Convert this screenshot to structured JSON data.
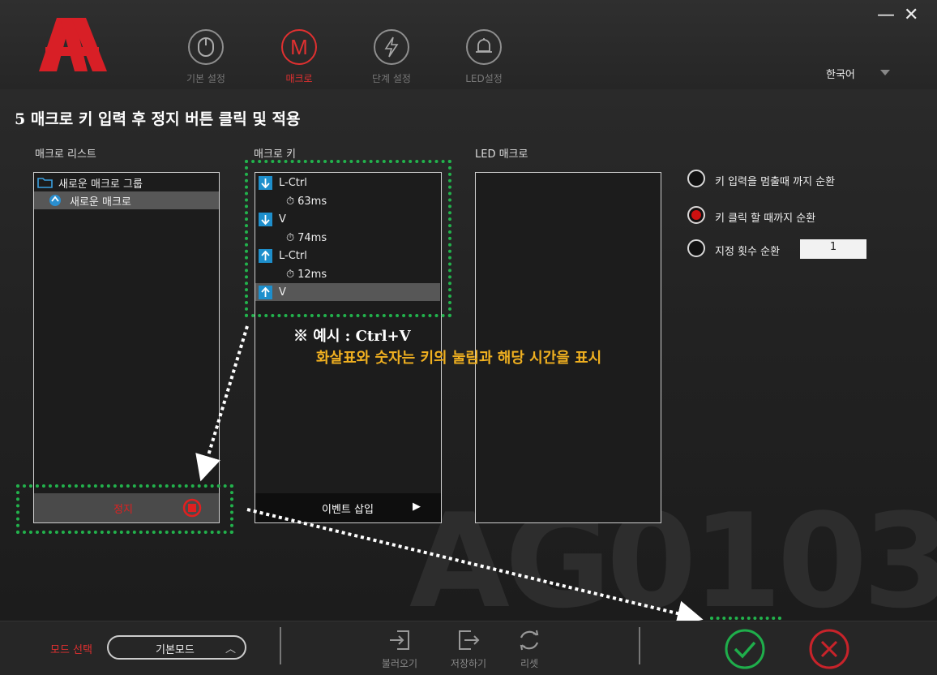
{
  "nav": {
    "tabs": [
      {
        "label": "기본 설정",
        "icon": "mouse-icon"
      },
      {
        "label": "매크로",
        "icon": "macro-m-icon",
        "active": true
      },
      {
        "label": "단계 설정",
        "icon": "lightning-icon"
      },
      {
        "label": "LED설정",
        "icon": "bell-icon"
      }
    ]
  },
  "window": {
    "minimize": "—",
    "close": "✕"
  },
  "language": "한국어",
  "instruction": "5 매크로 키 입력 후 정지 버튼 클릭 및 적용",
  "macro_list": {
    "title": "매크로 리스트",
    "group": "새로운 매크로 그룹",
    "item": "새로운 매크로",
    "stop_label": "정지"
  },
  "macro_keys": {
    "title": "매크로 키",
    "events": [
      {
        "dir": "down",
        "key": "L-Ctrl",
        "delay": "63ms"
      },
      {
        "dir": "down",
        "key": "V",
        "delay": "74ms"
      },
      {
        "dir": "up",
        "key": "L-Ctrl",
        "delay": "12ms"
      },
      {
        "dir": "up",
        "key": "V"
      }
    ],
    "insert_label": "이벤트 삽입"
  },
  "led_macro": {
    "title": "LED 매크로"
  },
  "options": {
    "loop_release": "키 입력을 멈출때 까지 순환",
    "loop_click": "키 클릭 할 때까지 순환",
    "loop_count": "지정 횟수 순환",
    "count_value": "1",
    "selected": "loop_click"
  },
  "annotation": {
    "line1": "※ 예시 : Ctrl+V",
    "line2": "화살표와 숫자는 키의 눌림과 해당 시간을 표시"
  },
  "watermark": "AG0103",
  "footer": {
    "mode_label": "모드 선택",
    "mode_value": "기본모드",
    "load": "불러오기",
    "save": "저장하기",
    "reset": "리셋"
  },
  "colors": {
    "accent": "#e03030",
    "highlight_green": "#22b24c",
    "annotation_yellow": "#f0b020",
    "key_blue": "#1e8fcc"
  }
}
